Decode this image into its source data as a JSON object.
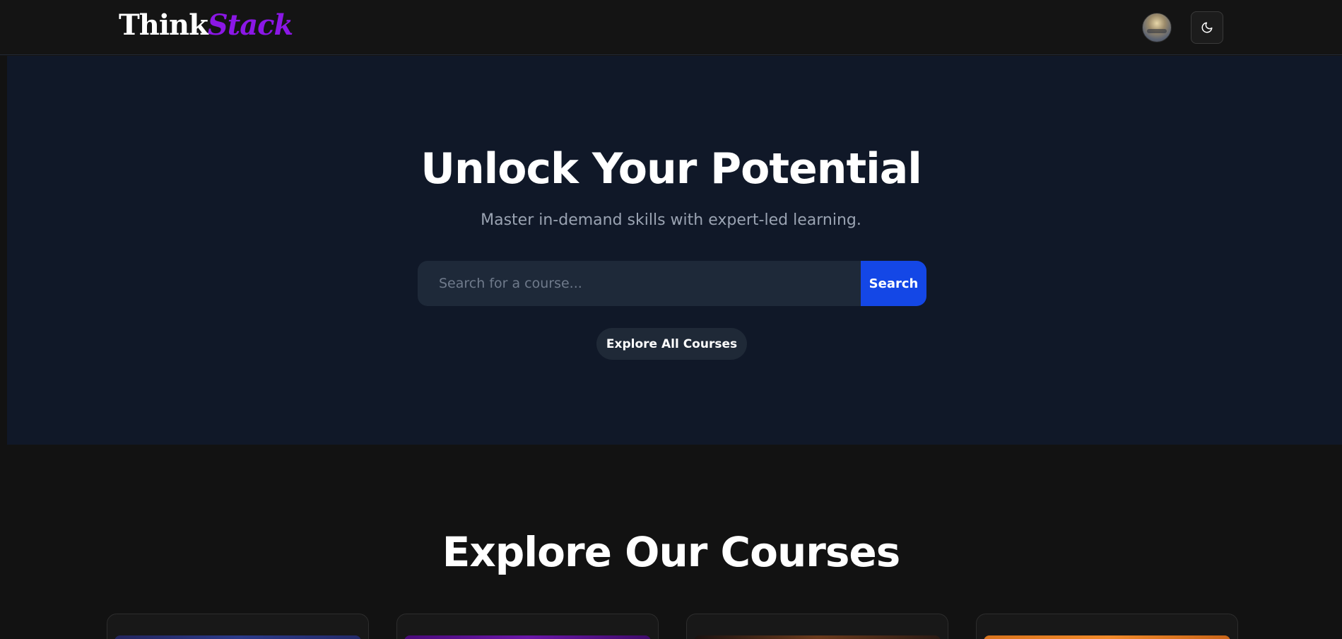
{
  "header": {
    "logo_part1": "Think",
    "logo_part2": "Stack",
    "avatar_icon": "user-avatar",
    "theme_toggle_icon": "moon-icon"
  },
  "hero": {
    "title": "Unlock Your Potential",
    "subtitle": "Master in-demand skills with expert-led learning.",
    "search": {
      "placeholder": "Search for a course...",
      "value": "",
      "button_label": "Search"
    },
    "explore_button_label": "Explore All Courses"
  },
  "courses": {
    "title": "Explore Our Courses",
    "card_count_visible": 4
  },
  "colors": {
    "page_bg": "#121212",
    "hero_bg": "#101828",
    "accent_purple": "#8b17e6",
    "search_button": "#1447e6",
    "input_bg": "#1e2939"
  }
}
